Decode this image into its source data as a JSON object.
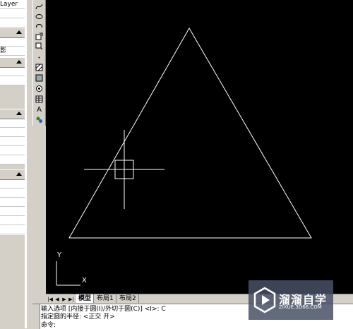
{
  "properties_palette": {
    "rows": [
      "Layer",
      "",
      "",
      "",
      "",
      "影",
      "",
      "",
      "",
      "",
      "",
      "",
      "",
      "",
      "",
      "",
      "",
      "",
      "",
      "",
      "",
      "",
      "",
      "",
      ""
    ]
  },
  "toolbar": {
    "icons": [
      "spline-icon",
      "ellipse-icon",
      "ellipse-arc-icon",
      "insert-block-icon",
      "make-block-icon",
      "point-icon",
      "hatch-icon",
      "gradient-icon",
      "region-icon",
      "table-icon",
      "multiline-text-icon",
      "add-selected-icon"
    ],
    "text_tool_glyph": "A"
  },
  "canvas": {
    "background": "#000000",
    "triangle_color": "#ffffff",
    "ucs": {
      "x_label": "X",
      "y_label": "Y"
    }
  },
  "tabs": {
    "items": [
      "模型",
      "布局1",
      "布局2"
    ],
    "active": "模型"
  },
  "command_line": {
    "lines": [
      "输入选项 [内接于圆(I)/外切于圆(C)] <I>: C",
      "指定圆的半径:  <正交 开>",
      "命令:"
    ]
  },
  "watermark": {
    "brand": "溜溜自学",
    "url": "ZIXUE.3D66.COM"
  }
}
